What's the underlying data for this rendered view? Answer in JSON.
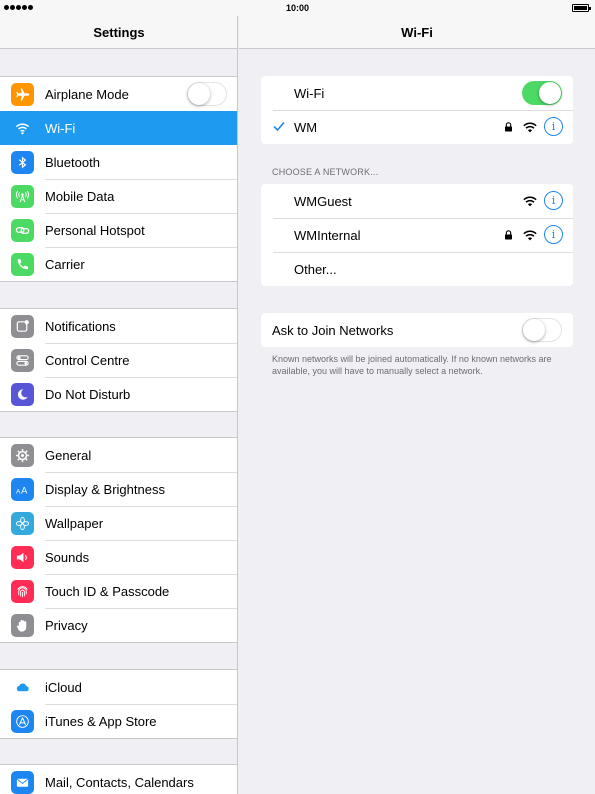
{
  "status": {
    "time": "10:00"
  },
  "settings": {
    "title": "Settings",
    "groups": [
      {
        "items": [
          {
            "label": "Airplane Mode",
            "icon": "airplane-icon",
            "color": "#ff9500",
            "toggle": false
          },
          {
            "label": "Wi-Fi",
            "icon": "wifi-icon",
            "color": "#1e9bf0",
            "selected": true
          },
          {
            "label": "Bluetooth",
            "icon": "bluetooth-icon",
            "color": "#1e86f0"
          },
          {
            "label": "Mobile Data",
            "icon": "antenna-icon",
            "color": "#4cd964"
          },
          {
            "label": "Personal Hotspot",
            "icon": "hotspot-icon",
            "color": "#4cd964"
          },
          {
            "label": "Carrier",
            "icon": "phone-icon",
            "color": "#4cd964"
          }
        ]
      },
      {
        "items": [
          {
            "label": "Notifications",
            "icon": "notifications-icon",
            "color": "#8e8e93"
          },
          {
            "label": "Control Centre",
            "icon": "control-centre-icon",
            "color": "#8e8e93"
          },
          {
            "label": "Do Not Disturb",
            "icon": "moon-icon",
            "color": "#5856d6"
          }
        ]
      },
      {
        "items": [
          {
            "label": "General",
            "icon": "gear-icon",
            "color": "#8e8e93"
          },
          {
            "label": "Display & Brightness",
            "icon": "display-icon",
            "color": "#1e86f0"
          },
          {
            "label": "Wallpaper",
            "icon": "wallpaper-icon",
            "color": "#34aadc"
          },
          {
            "label": "Sounds",
            "icon": "speaker-icon",
            "color": "#ff2d55"
          },
          {
            "label": "Touch ID & Passcode",
            "icon": "fingerprint-icon",
            "color": "#ff2d55"
          },
          {
            "label": "Privacy",
            "icon": "hand-icon",
            "color": "#8e8e93"
          }
        ]
      },
      {
        "items": [
          {
            "label": "iCloud",
            "icon": "cloud-icon",
            "color": "#ffffff"
          },
          {
            "label": "iTunes & App Store",
            "icon": "app-store-icon",
            "color": "#1e86f0"
          }
        ]
      },
      {
        "items": [
          {
            "label": "Mail, Contacts, Calendars",
            "icon": "mail-icon",
            "color": "#1e86f0"
          }
        ]
      }
    ]
  },
  "wifi": {
    "title": "Wi-Fi",
    "toggle_label": "Wi-Fi",
    "wifi_enabled": true,
    "connected_network": "WM",
    "choose_label": "CHOOSE A NETWORK...",
    "networks": [
      {
        "name": "WMGuest",
        "secured": false
      },
      {
        "name": "WMInternal",
        "secured": true
      }
    ],
    "other_label": "Other...",
    "ask_label": "Ask to Join Networks",
    "ask_enabled": false,
    "footnote": "Known networks will be joined automatically. If no known networks are available, you will have to manually select a network.",
    "accent": "#1e86f0",
    "toggle_on_color": "#4cd964"
  }
}
